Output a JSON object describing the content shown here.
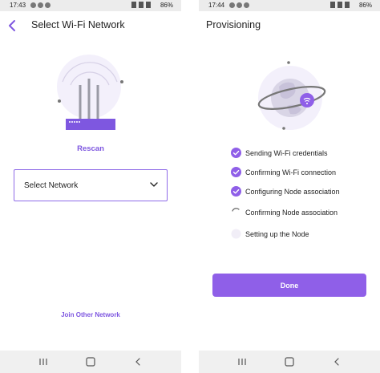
{
  "theme": {
    "accent": "#7e57e0",
    "button": "#8f5fe8",
    "status_bar": "#ececec",
    "nav_bar": "#f0f0f0"
  },
  "left": {
    "status": {
      "time": "17:43",
      "battery": "86%"
    },
    "header": {
      "title": "Select Wi-Fi Network",
      "back_icon": "chevron-left-icon"
    },
    "rescan_label": "Rescan",
    "network_select": {
      "value": "Select Network",
      "icon": "chevron-down-icon"
    },
    "join_other_label": "Join Other Network"
  },
  "right": {
    "status": {
      "time": "17:44",
      "battery": "86%"
    },
    "header": {
      "title": "Provisioning"
    },
    "steps": [
      {
        "label": "Sending Wi-Fi credentials",
        "state": "done"
      },
      {
        "label": "Confirming Wi-Fi connection",
        "state": "done"
      },
      {
        "label": "Configuring Node association",
        "state": "done"
      },
      {
        "label": "Confirming Node association",
        "state": "in-progress"
      },
      {
        "label": "Setting up the Node",
        "state": "pending"
      }
    ],
    "done_label": "Done"
  },
  "nav_bar": {
    "icons": [
      "recent-apps-icon",
      "home-icon",
      "back-icon"
    ]
  }
}
